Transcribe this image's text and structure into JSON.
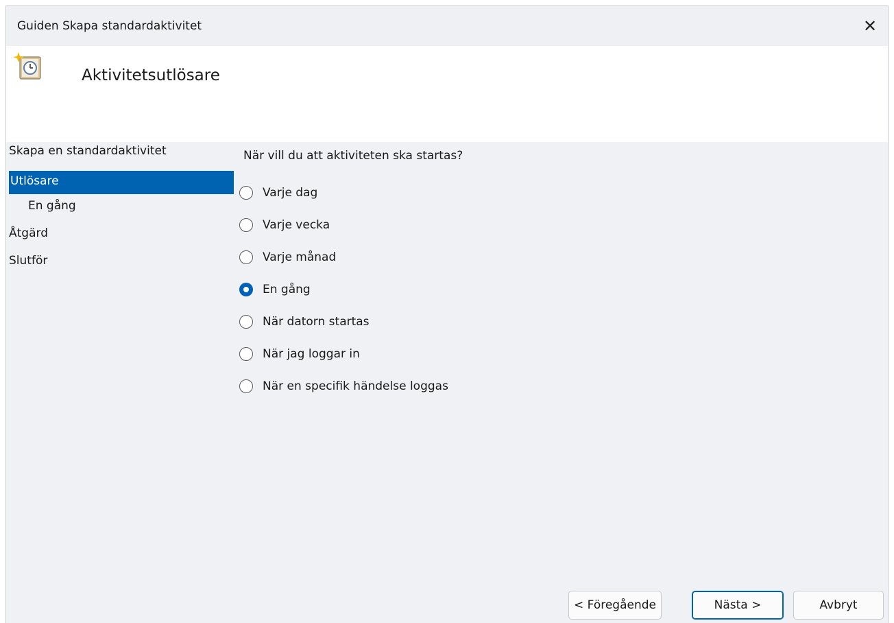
{
  "window": {
    "title": "Guiden Skapa standardaktivitet",
    "close_glyph": "✕"
  },
  "header": {
    "icon": "scheduled-task-clock-icon",
    "title": "Aktivitetsutlösare"
  },
  "nav": {
    "items": [
      {
        "label": "Skapa en standardaktivitet",
        "selected": false,
        "sub": false
      },
      {
        "label": "Utlösare",
        "selected": true,
        "sub": false
      },
      {
        "label": "En gång",
        "selected": false,
        "sub": true
      },
      {
        "label": "Åtgärd",
        "selected": false,
        "sub": false
      },
      {
        "label": "Slutför",
        "selected": false,
        "sub": false
      }
    ]
  },
  "main": {
    "question": "När vill du att aktiviteten ska startas?",
    "options": [
      {
        "label": "Varje dag",
        "checked": false
      },
      {
        "label": "Varje vecka",
        "checked": false
      },
      {
        "label": "Varje månad",
        "checked": false
      },
      {
        "label": "En gång",
        "checked": true
      },
      {
        "label": "När datorn startas",
        "checked": false
      },
      {
        "label": "När jag loggar in",
        "checked": false
      },
      {
        "label": "När en specifik händelse loggas",
        "checked": false
      }
    ]
  },
  "buttons": {
    "prev": "< Föregående",
    "next": "Nästa >",
    "cancel": "Avbryt"
  },
  "colors": {
    "accent": "#0063b1",
    "nav_selected_text": "#ffffff"
  }
}
